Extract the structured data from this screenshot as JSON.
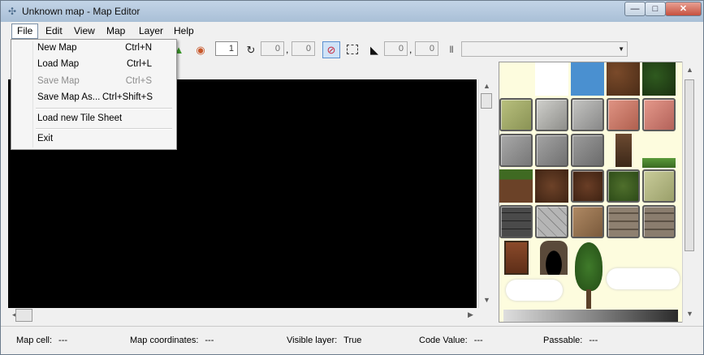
{
  "window": {
    "title": "Unknown map - Map Editor",
    "controls": {
      "minimize": "—",
      "maximize": "□",
      "close": "✕"
    }
  },
  "menubar": {
    "items": [
      "File",
      "Edit",
      "View",
      "Map",
      "Layer",
      "Help"
    ]
  },
  "file_menu": {
    "items": [
      {
        "label": "New Map",
        "shortcut": "Ctrl+N",
        "enabled": true
      },
      {
        "label": "Load Map",
        "shortcut": "Ctrl+L",
        "enabled": true
      },
      {
        "label": "Save Map",
        "shortcut": "Ctrl+S",
        "enabled": false
      },
      {
        "label": "Save Map As...",
        "shortcut": "Ctrl+Shift+S",
        "enabled": true
      },
      {
        "label": "Load new Tile Sheet",
        "shortcut": "",
        "enabled": true
      },
      {
        "label": "Exit",
        "shortcut": "",
        "enabled": true
      }
    ]
  },
  "toolbar": {
    "layer_number": "1",
    "rotation_x": "0",
    "rotation_y": "0",
    "selection_x": "0",
    "selection_y": "0",
    "comma": ",",
    "code_value": ""
  },
  "status": {
    "map_cell_label": "Map cell:",
    "map_cell_value": "---",
    "map_coordinates_label": "Map coordinates:",
    "map_coordinates_value": "---",
    "visible_layer_label": "Visible layer:",
    "visible_layer_value": "True",
    "code_value_label": "Code Value:",
    "code_value_value": "---",
    "passable_label": "Passable:",
    "passable_value": "---"
  },
  "tiles": {
    "colors": {
      "accent_blue": "#4a90d0",
      "map_background": "#000000",
      "tile_sheet_background": "#fdfcde"
    }
  }
}
